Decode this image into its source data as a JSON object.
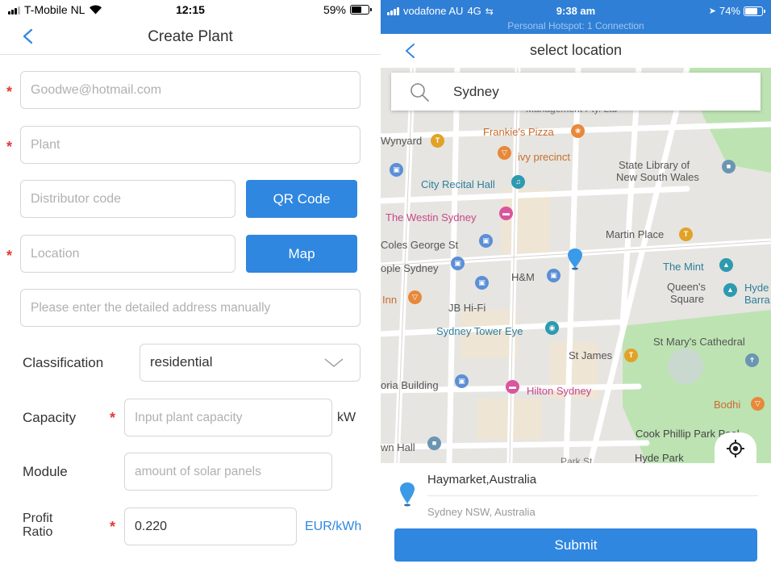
{
  "left": {
    "status": {
      "carrier": "T-Mobile NL",
      "time": "12:15",
      "battery": "59%",
      "battery_level": 0.59
    },
    "title": "Create Plant",
    "email_placeholder": "Goodwe@hotmail.com",
    "plant_placeholder": "Plant",
    "distributor_placeholder": "Distributor code",
    "qr_label": "QR Code",
    "location_placeholder": "Location",
    "map_label": "Map",
    "address_placeholder": "Please enter the detailed address manually",
    "classification_label": "Classification",
    "classification_value": "residential",
    "capacity_label": "Capacity",
    "capacity_placeholder": "Input plant capacity",
    "capacity_unit": "kW",
    "module_label": "Module",
    "module_placeholder": "amount of solar panels",
    "profit_label_1": "Profit",
    "profit_label_2": "Ratio",
    "profit_value": "0.220",
    "profit_unit": "EUR/kWh",
    "required_mark": "*",
    "colors": {
      "accent": "#2f87e0",
      "required": "#e53935"
    }
  },
  "right": {
    "status": {
      "carrier": "vodafone AU",
      "network": "4G",
      "time": "9:38 am",
      "battery": "74%",
      "battery_level": 0.74
    },
    "hotspot": "Personal Hotspot: 1 Connection",
    "title": "select location",
    "search_value": "Sydney",
    "map_labels": {
      "management": "Management Pty. Ltd",
      "frankies": "Frankie's Pizza",
      "wynyard": "Wynyard",
      "ivy": "ivy precinct",
      "statelib_1": "State Library of",
      "statelib_2": "New South Wales",
      "city_recital": "City Recital Hall",
      "westin": "The Westin Sydney",
      "martin": "Martin Place",
      "coles": "Coles George St",
      "ople": "ople Sydney",
      "mint": "The Mint",
      "hm": "H&M",
      "queens_1": "Queen's",
      "queens_2": "Square",
      "hyde_1": "Hyde",
      "hyde_2": "Barra",
      "inn": "Inn",
      "jbhifi": "JB Hi-Fi",
      "tower": "Sydney Tower Eye",
      "stmarys": "St Mary's Cathedral",
      "stjames": "St James",
      "oria": "oria Building",
      "hilton": "Hilton Sydney",
      "bodhi": "Bodhi",
      "cook": "Cook Phillip Park Pool",
      "wnhall": "wn Hall",
      "hydepark": "Hyde Park",
      "park_st": "Park St"
    },
    "result_title": "Haymarket,Australia",
    "result_sub": "Sydney NSW, Australia",
    "submit_label": "Submit",
    "colors": {
      "header": "#2f7fd6",
      "pin": "#3a9ae8",
      "park": "#bde3b3"
    }
  }
}
